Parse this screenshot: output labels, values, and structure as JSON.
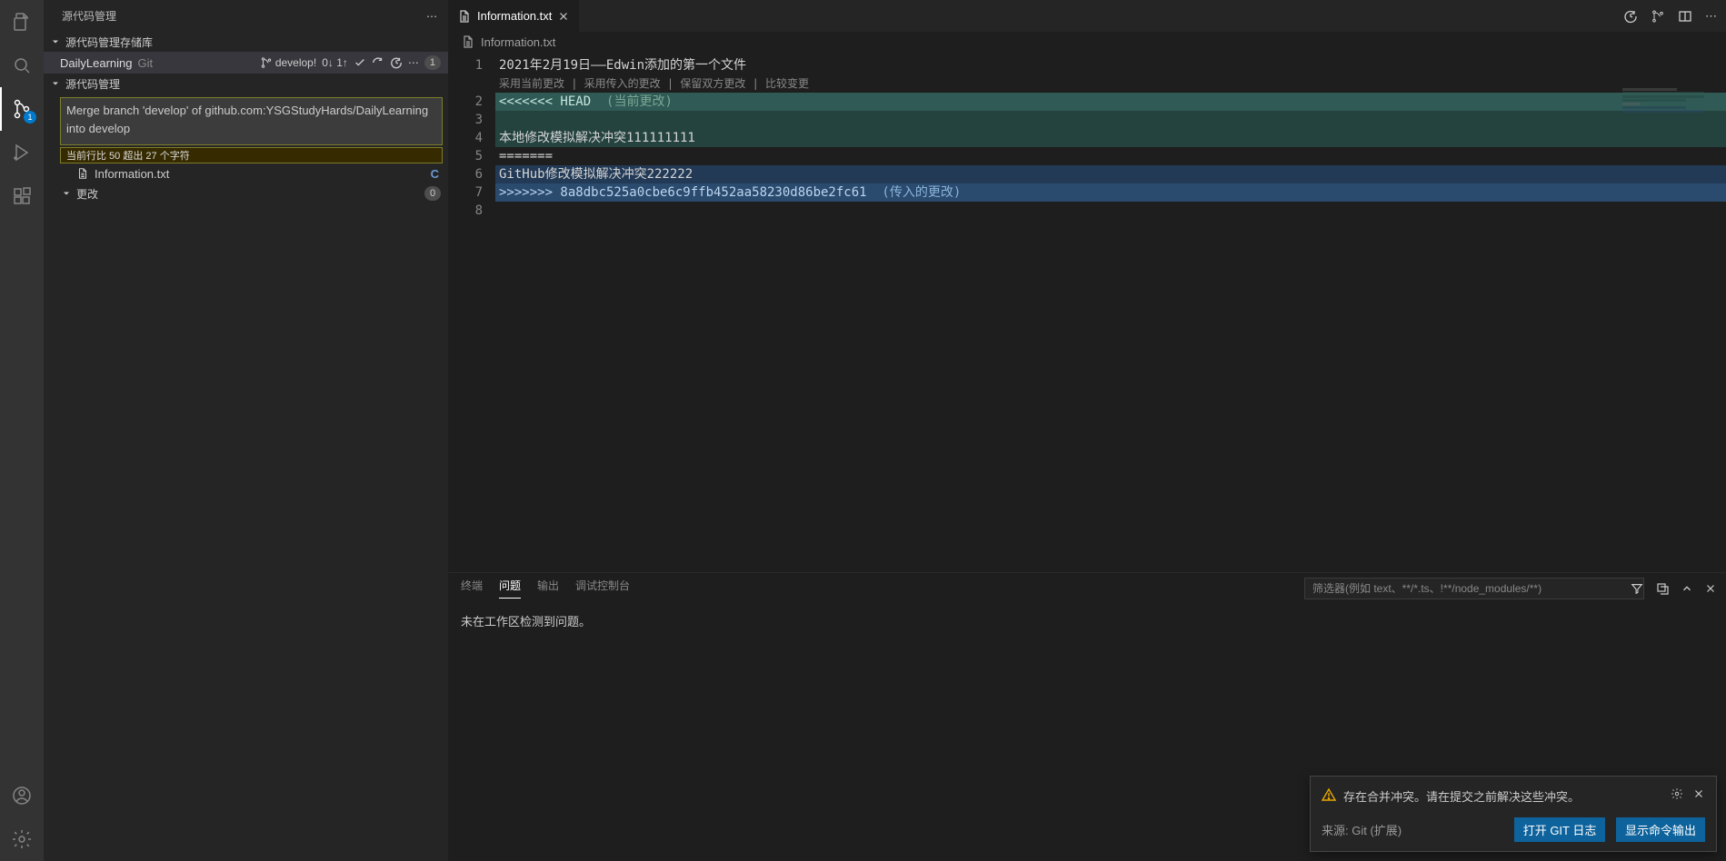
{
  "activitybar": {
    "scm_badge": "1"
  },
  "sidebar": {
    "title": "源代码管理",
    "repos_section": "源代码管理存储库",
    "repo_name": "DailyLearning",
    "repo_vcs": "Git",
    "branch": "develop!",
    "sync": "0↓ 1↑",
    "pending_badge": "1",
    "scm_section": "源代码管理",
    "commit_message": "Merge branch 'develop' of github.com:YSGStudyHards/DailyLearning into develop",
    "commit_warning": "当前行比 50 超出 27 个字符",
    "merge_file": "Information.txt",
    "merge_status": "C",
    "changes_label": "更改",
    "changes_count": "0"
  },
  "tabs": {
    "file": "Information.txt"
  },
  "breadcrumb": {
    "file": "Information.txt"
  },
  "editor": {
    "codelens": "采用当前更改 | 采用传入的更改 | 保留双方更改 | 比较变更",
    "l1": "2021年2月19日——Edwin添加的第一个文件",
    "l2a": "<<<<<<< HEAD",
    "l2b": "  (当前更改)",
    "l3": "",
    "l4": "本地修改模拟解决冲突111111111",
    "l5": "=======",
    "l6": "GitHub修改模拟解决冲突222222",
    "l7a": ">>>>>>> 8a8dbc525a0cbe6c9ffb452aa58230d86be2fc61",
    "l7b": "  (传入的更改)",
    "nums": [
      "1",
      "2",
      "3",
      "4",
      "5",
      "6",
      "7",
      "8"
    ]
  },
  "panel": {
    "tabs": {
      "terminal": "终端",
      "problems": "问题",
      "output": "输出",
      "debug": "调试控制台"
    },
    "filter_placeholder": "筛选器(例如 text、**/*.ts、!**/node_modules/**)",
    "body": "未在工作区检测到问题。"
  },
  "toast": {
    "message": "存在合并冲突。请在提交之前解决这些冲突。",
    "source": "来源: Git (扩展)",
    "btn1": "打开 GIT 日志",
    "btn2": "显示命令输出"
  }
}
